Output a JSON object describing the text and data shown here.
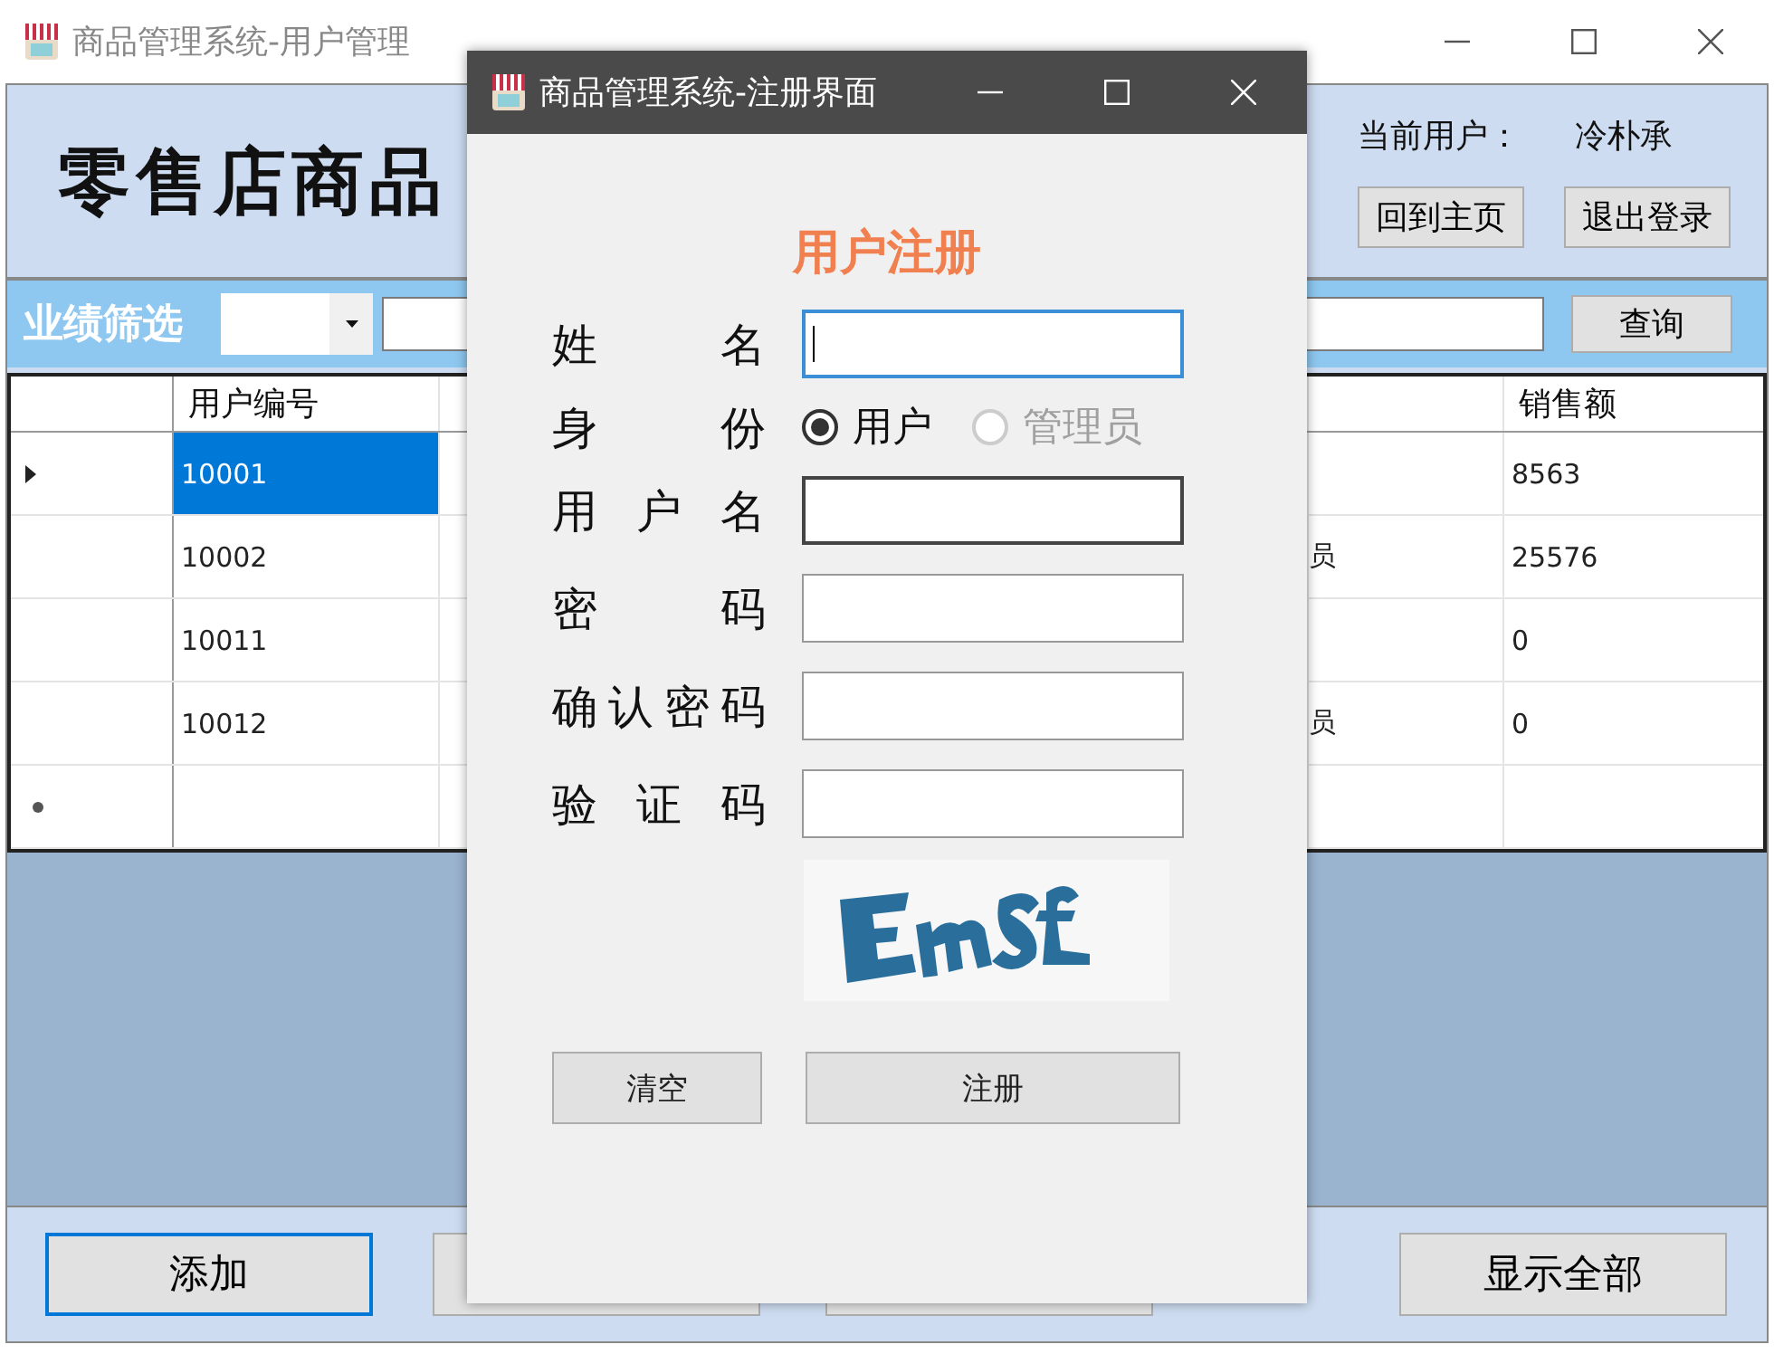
{
  "main_window": {
    "title": "商品管理系统-用户管理",
    "banner_title": "零售店商品",
    "current_user_label": "当前用户：",
    "current_user": "冷朴承",
    "header_buttons": [
      "回到主页",
      "退出登录"
    ]
  },
  "filter": {
    "label": "业绩筛选",
    "search_button": "查询"
  },
  "table": {
    "header": {
      "column_2": "用户编号",
      "column_5": "销售额"
    },
    "rows": [
      {
        "selected": true,
        "column_2": "10001",
        "column_5": "8563"
      },
      {
        "selected": false,
        "column_2": "10002",
        "column_4": "员",
        "column_5": "25576"
      },
      {
        "selected": false,
        "column_2": "10011",
        "column_5": "0"
      },
      {
        "selected": false,
        "column_2": "10012",
        "column_4": "员",
        "column_5": "0"
      }
    ],
    "new_row": true
  },
  "bottom_buttons": [
    {
      "label": "添加",
      "focused": true
    },
    {
      "focused": false
    },
    {
      "focused": false
    },
    {
      "label": "显示全部",
      "focused": false
    }
  ],
  "dialog": {
    "title": "商品管理系统-注册界面",
    "heading": "用户注册",
    "fields": [
      {
        "kind": "text",
        "label": "姓 名",
        "focused": true,
        "hovered": false
      },
      {
        "kind": "radio",
        "label": "身 份",
        "options": [
          {
            "label": "用户",
            "selected": true,
            "disabled": false
          },
          {
            "label": "管理员",
            "selected": false,
            "disabled": true
          }
        ]
      },
      {
        "kind": "text",
        "label": "用 户 名",
        "focused": false,
        "hovered": true
      },
      {
        "kind": "text",
        "label": "密 码",
        "focused": false,
        "hovered": false
      },
      {
        "kind": "text",
        "label": "确认密码",
        "focused": false,
        "hovered": false
      },
      {
        "kind": "text",
        "label": "验 证 码",
        "focused": false,
        "hovered": false
      }
    ],
    "buttons": [
      "清空",
      "注册"
    ]
  }
}
